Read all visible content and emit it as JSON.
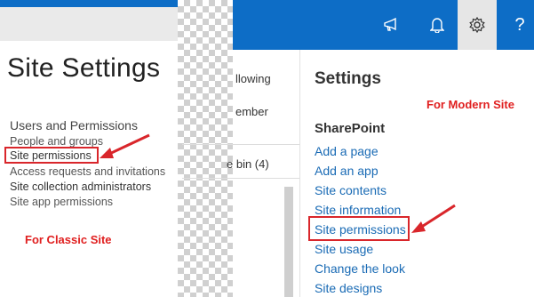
{
  "classic": {
    "title": "Site Settings",
    "section_heading": "Users and Permissions",
    "links": [
      "People and groups",
      "Site permissions",
      "Access requests and invitations",
      "Site collection administrators",
      "Site app permissions"
    ],
    "annotation": "For Classic Site"
  },
  "middle": {
    "follow_fragment": "llowing",
    "member_fragment": "ember",
    "recycle_fragment": "e bin (4)"
  },
  "suite_bar": {
    "icons": [
      "megaphone-icon",
      "bell-icon",
      "gear-icon",
      "help-icon"
    ],
    "help_label": "?"
  },
  "settings_panel": {
    "title": "Settings",
    "annotation": "For Modern Site",
    "sharepoint_heading": "SharePoint",
    "links": [
      "Add a page",
      "Add an app",
      "Site contents",
      "Site information",
      "Site permissions",
      "Site usage",
      "Change the look",
      "Site designs"
    ]
  },
  "colors": {
    "suite_blue": "#0d6dc6",
    "link_blue": "#1a6bb5",
    "annotation_red": "#e02020"
  }
}
